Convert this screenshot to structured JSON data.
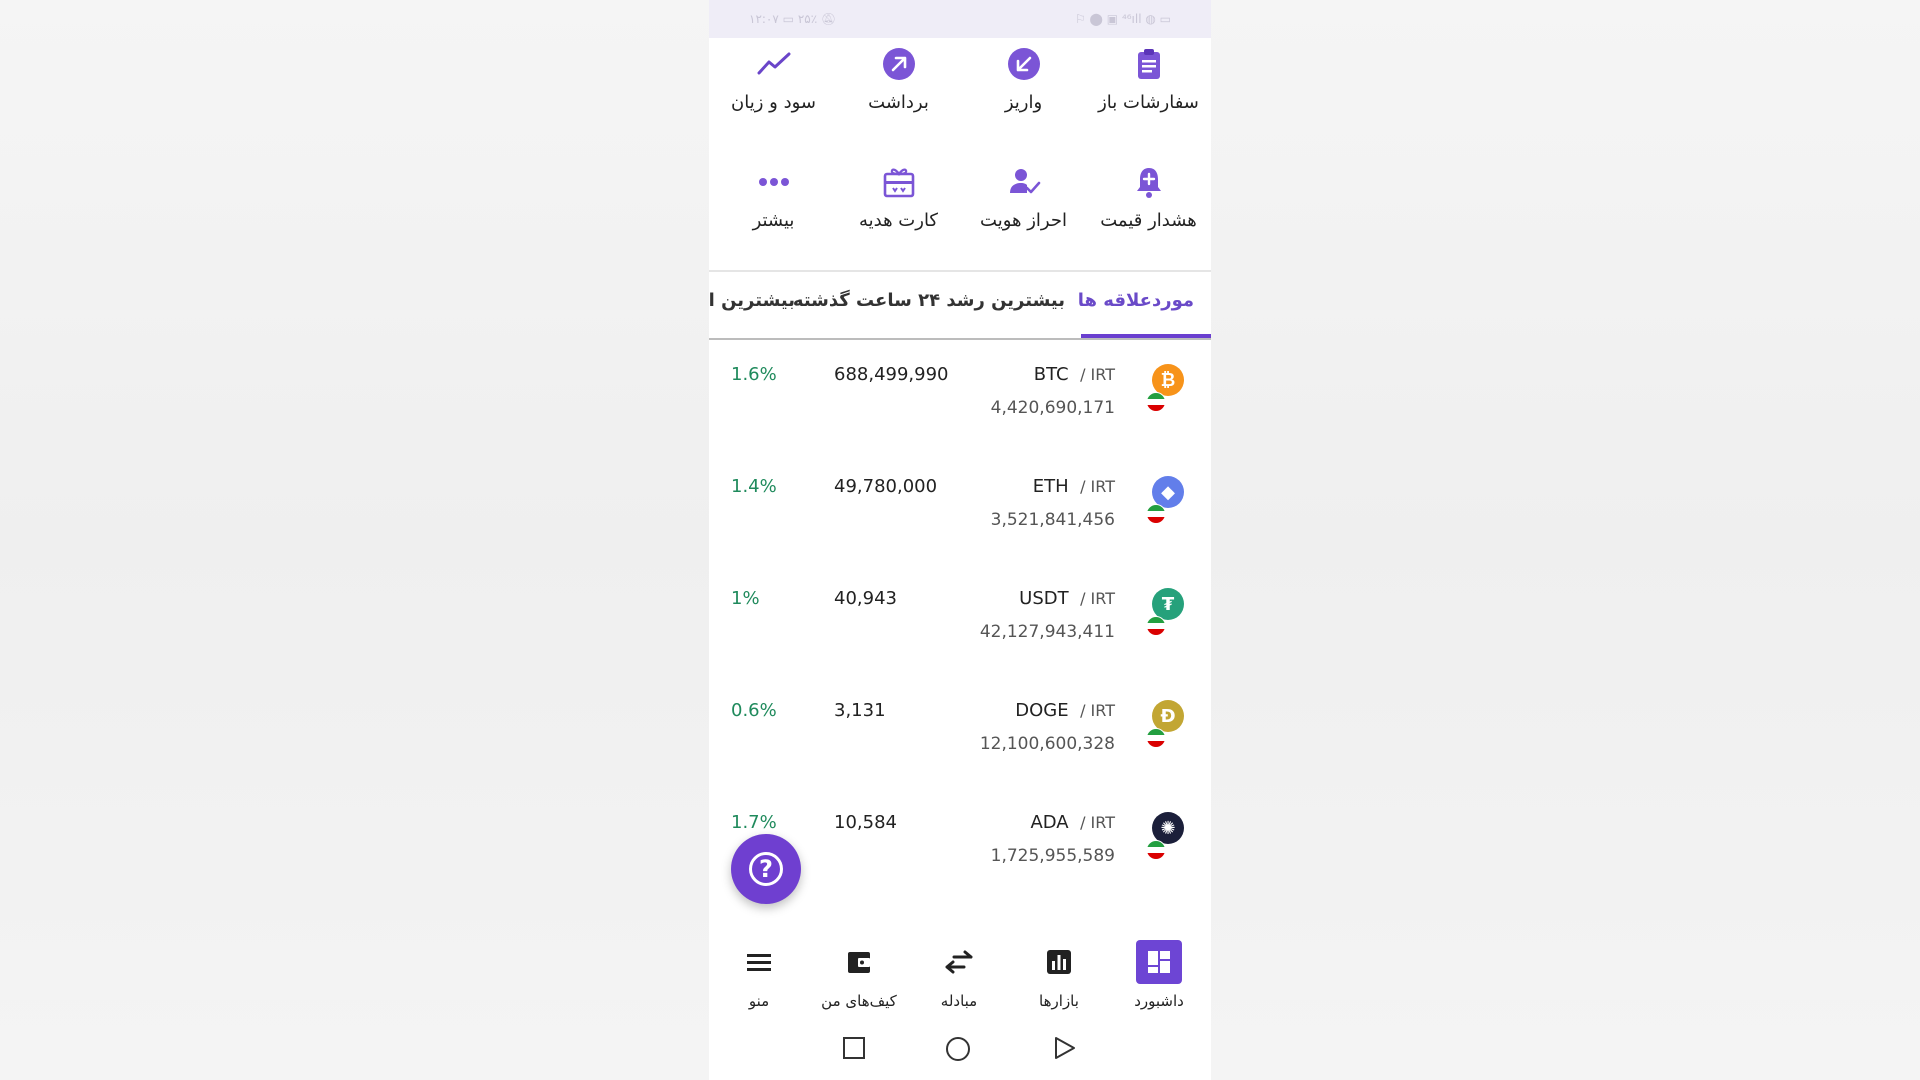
{
  "status_bar": {
    "time": "۱۲:۰۷",
    "battery": "۲۵٪",
    "right_icons": "⚐ ⬤ ▣ ⁴⁶ıll ◍ ▭"
  },
  "quick_actions": [
    {
      "label": "سفارشات باز",
      "icon": "clipboard-icon"
    },
    {
      "label": "واریز",
      "icon": "arrow-down-left-icon"
    },
    {
      "label": "برداشت",
      "icon": "arrow-up-right-icon"
    },
    {
      "label": "سود و زیان",
      "icon": "trend-line-icon"
    },
    {
      "label": "هشدار قیمت",
      "icon": "bell-plus-icon"
    },
    {
      "label": "احراز هویت",
      "icon": "user-check-icon"
    },
    {
      "label": "کارت هدیه",
      "icon": "gift-card-icon"
    },
    {
      "label": "بیشتر",
      "icon": "more-dots-icon"
    }
  ],
  "tabs": [
    {
      "label": "موردعلاقه ها",
      "active": true
    },
    {
      "label": "بیشترین رشد ۲۴ ساعت گذشته",
      "active": false
    },
    {
      "label": "بیشترین اف",
      "active": false
    }
  ],
  "markets": [
    {
      "symbol": "BTC",
      "quote": "/ IRT",
      "volume": "4,420,690,171",
      "price": "688,499,990",
      "change": "1.6%",
      "icon_color": "#f7931a",
      "glyph": "₿"
    },
    {
      "symbol": "ETH",
      "quote": "/ IRT",
      "volume": "3,521,841,456",
      "price": "49,780,000",
      "change": "1.4%",
      "icon_color": "#627eea",
      "glyph": "◆"
    },
    {
      "symbol": "USDT",
      "quote": "/ IRT",
      "volume": "42,127,943,411",
      "price": "40,943",
      "change": "1%",
      "icon_color": "#26a17b",
      "glyph": "₮"
    },
    {
      "symbol": "DOGE",
      "quote": "/ IRT",
      "volume": "12,100,600,328",
      "price": "3,131",
      "change": "0.6%",
      "icon_color": "#c2a633",
      "glyph": "Ð"
    },
    {
      "symbol": "ADA",
      "quote": "/ IRT",
      "volume": "1,725,955,589",
      "price": "10,584",
      "change": "1.7%",
      "icon_color": "#1b1f3a",
      "glyph": "✺"
    }
  ],
  "help_button": {
    "glyph": "?"
  },
  "bottom_nav": [
    {
      "label": "داشبورد",
      "icon": "dashboard-icon",
      "active": true
    },
    {
      "label": "بازارها",
      "icon": "markets-chart-icon",
      "active": false
    },
    {
      "label": "مبادله",
      "icon": "exchange-arrows-icon",
      "active": false
    },
    {
      "label": "کیف‌های من",
      "icon": "wallet-icon",
      "active": false
    },
    {
      "label": "منو",
      "icon": "menu-icon",
      "active": false
    }
  ],
  "colors": {
    "accent": "#6a3fcf",
    "positive": "#1f8a5c"
  }
}
